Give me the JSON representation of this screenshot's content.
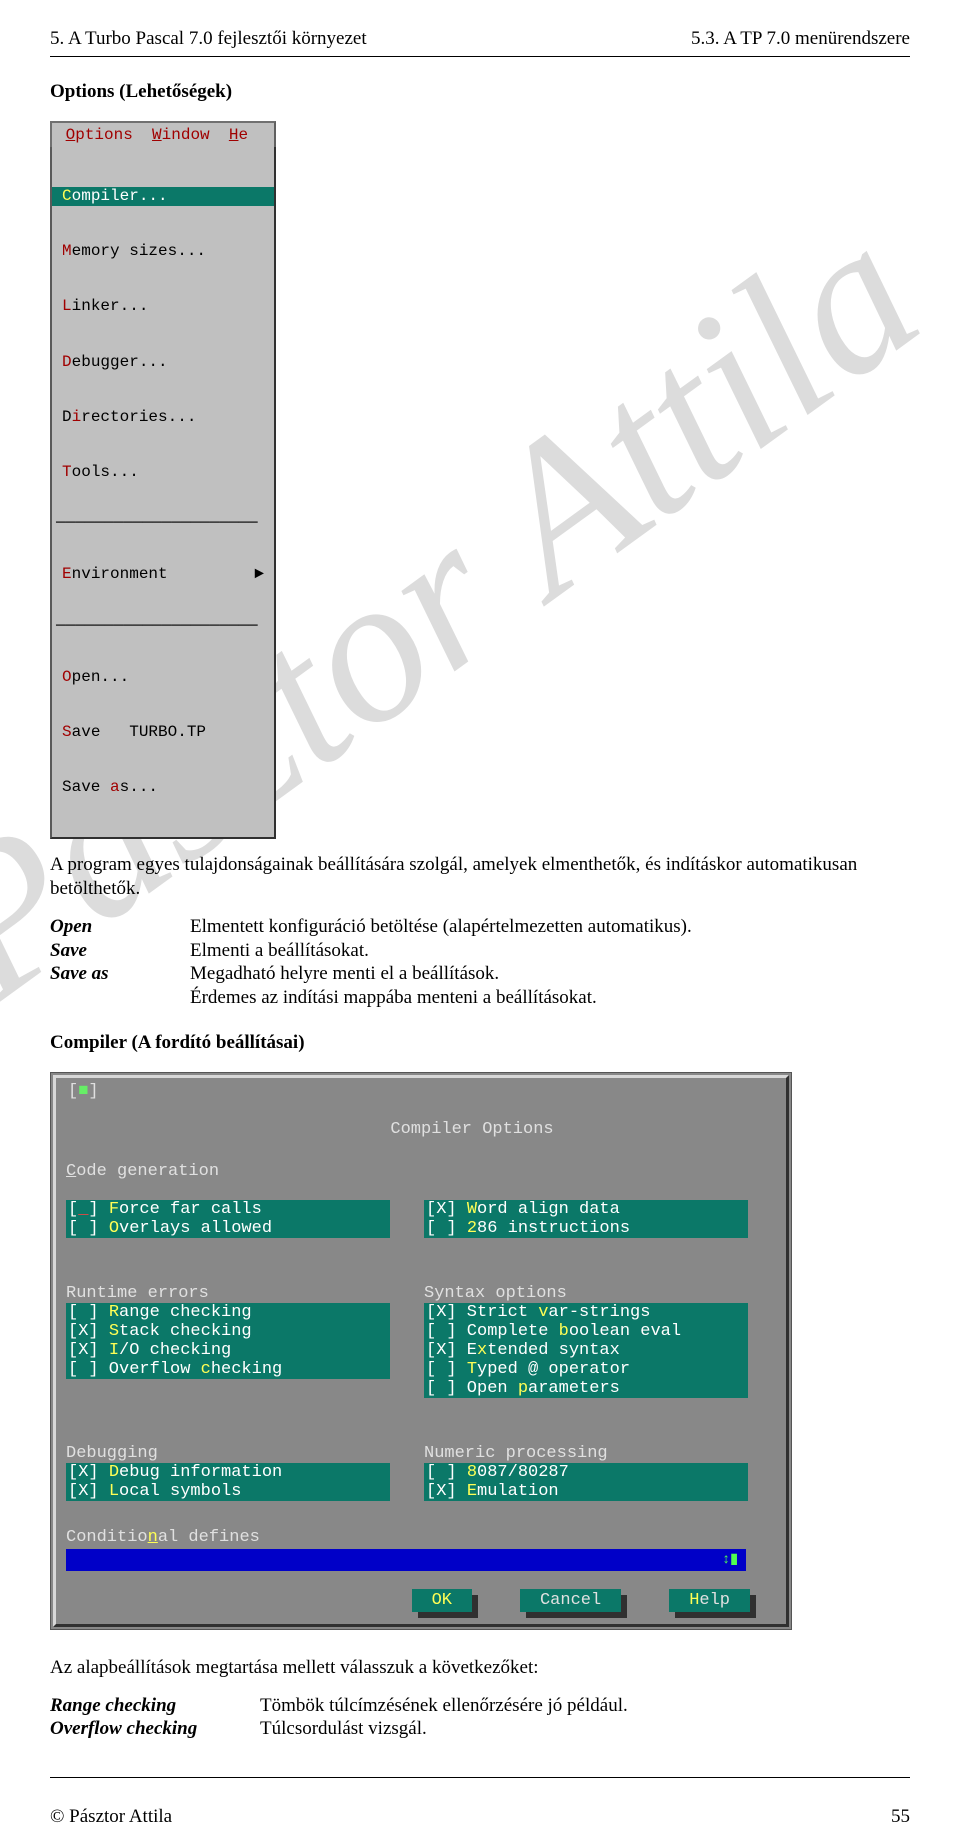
{
  "header": {
    "left": "5. A Turbo Pascal 7.0 fejlesztői környezet",
    "right": "5.3. A TP 7.0 menürendszere"
  },
  "watermark": "Pásztor Attila",
  "section1_title": "Options (Lehetőségek)",
  "menu_bar": {
    "options": "Options",
    "window": "Window",
    "help_initial": "He"
  },
  "options_menu": {
    "compiler": "Compiler...",
    "memory": "Memory sizes...",
    "linker": "Linker...",
    "debugger": "Debugger...",
    "directories": "Directories...",
    "tools": "Tools...",
    "environment": "Environment",
    "env_arrow": "►",
    "open": "Open...",
    "save": "Save   TURBO.TP",
    "save_as": "Save as..."
  },
  "options_para": "A program egyes tulajdonságainak beállítására szolgál, amelyek elmenthetők, és indításkor automatikusan betölthetők.",
  "defs": {
    "open_k": "Open",
    "open_v": "Elmentett konfiguráció betöltése (alapértelmezetten automatikus).",
    "save_k": "Save",
    "save_v": "Elmenti a beállításokat.",
    "saveas_k": "Save as",
    "saveas_v1": "Megadható helyre menti el a beállítások.",
    "saveas_v2": "Érdemes az indítási mappába menteni a beállításokat."
  },
  "compiler_heading": "Compiler (A fordító beállításai)",
  "dialog": {
    "title": "Compiler Options",
    "groups": {
      "code_gen": "Code generation",
      "force_far": "Force far calls",
      "overlays": "Overlays allowed",
      "word_align": "Word align data",
      "i286": "286 instructions",
      "runtime": "Runtime errors",
      "range": "Range checking",
      "stack": "Stack checking",
      "io": "I/O checking",
      "overflow": "Overflow checking",
      "syntax": "Syntax options",
      "strict": "Strict var-strings",
      "complete": "Complete boolean eval",
      "extended": "Extended syntax",
      "typed": "Typed @ operator",
      "openparams": "Open parameters",
      "debugging": "Debugging",
      "debuginfo": "Debug information",
      "localsym": "Local symbols",
      "numeric": "Numeric processing",
      "n8087": "8087/80287",
      "emul": "Emulation",
      "cond": "Conditional defines"
    },
    "cond_cursor": "↕▮",
    "buttons": {
      "ok": "OK",
      "cancel": "Cancel",
      "help": "Help"
    }
  },
  "after_dialog": {
    "line1": "Az alapbeállítások megtartása mellett válasszuk a következőket:",
    "range_k": "Range checking",
    "range_v": "Tömbök túlcímzésének ellenőrzésére jó például.",
    "overflow_k": "Overflow checking",
    "overflow_v": "Túlcsordulást vizsgál."
  },
  "footer": {
    "left": "© Pásztor Attila",
    "right": "55"
  }
}
